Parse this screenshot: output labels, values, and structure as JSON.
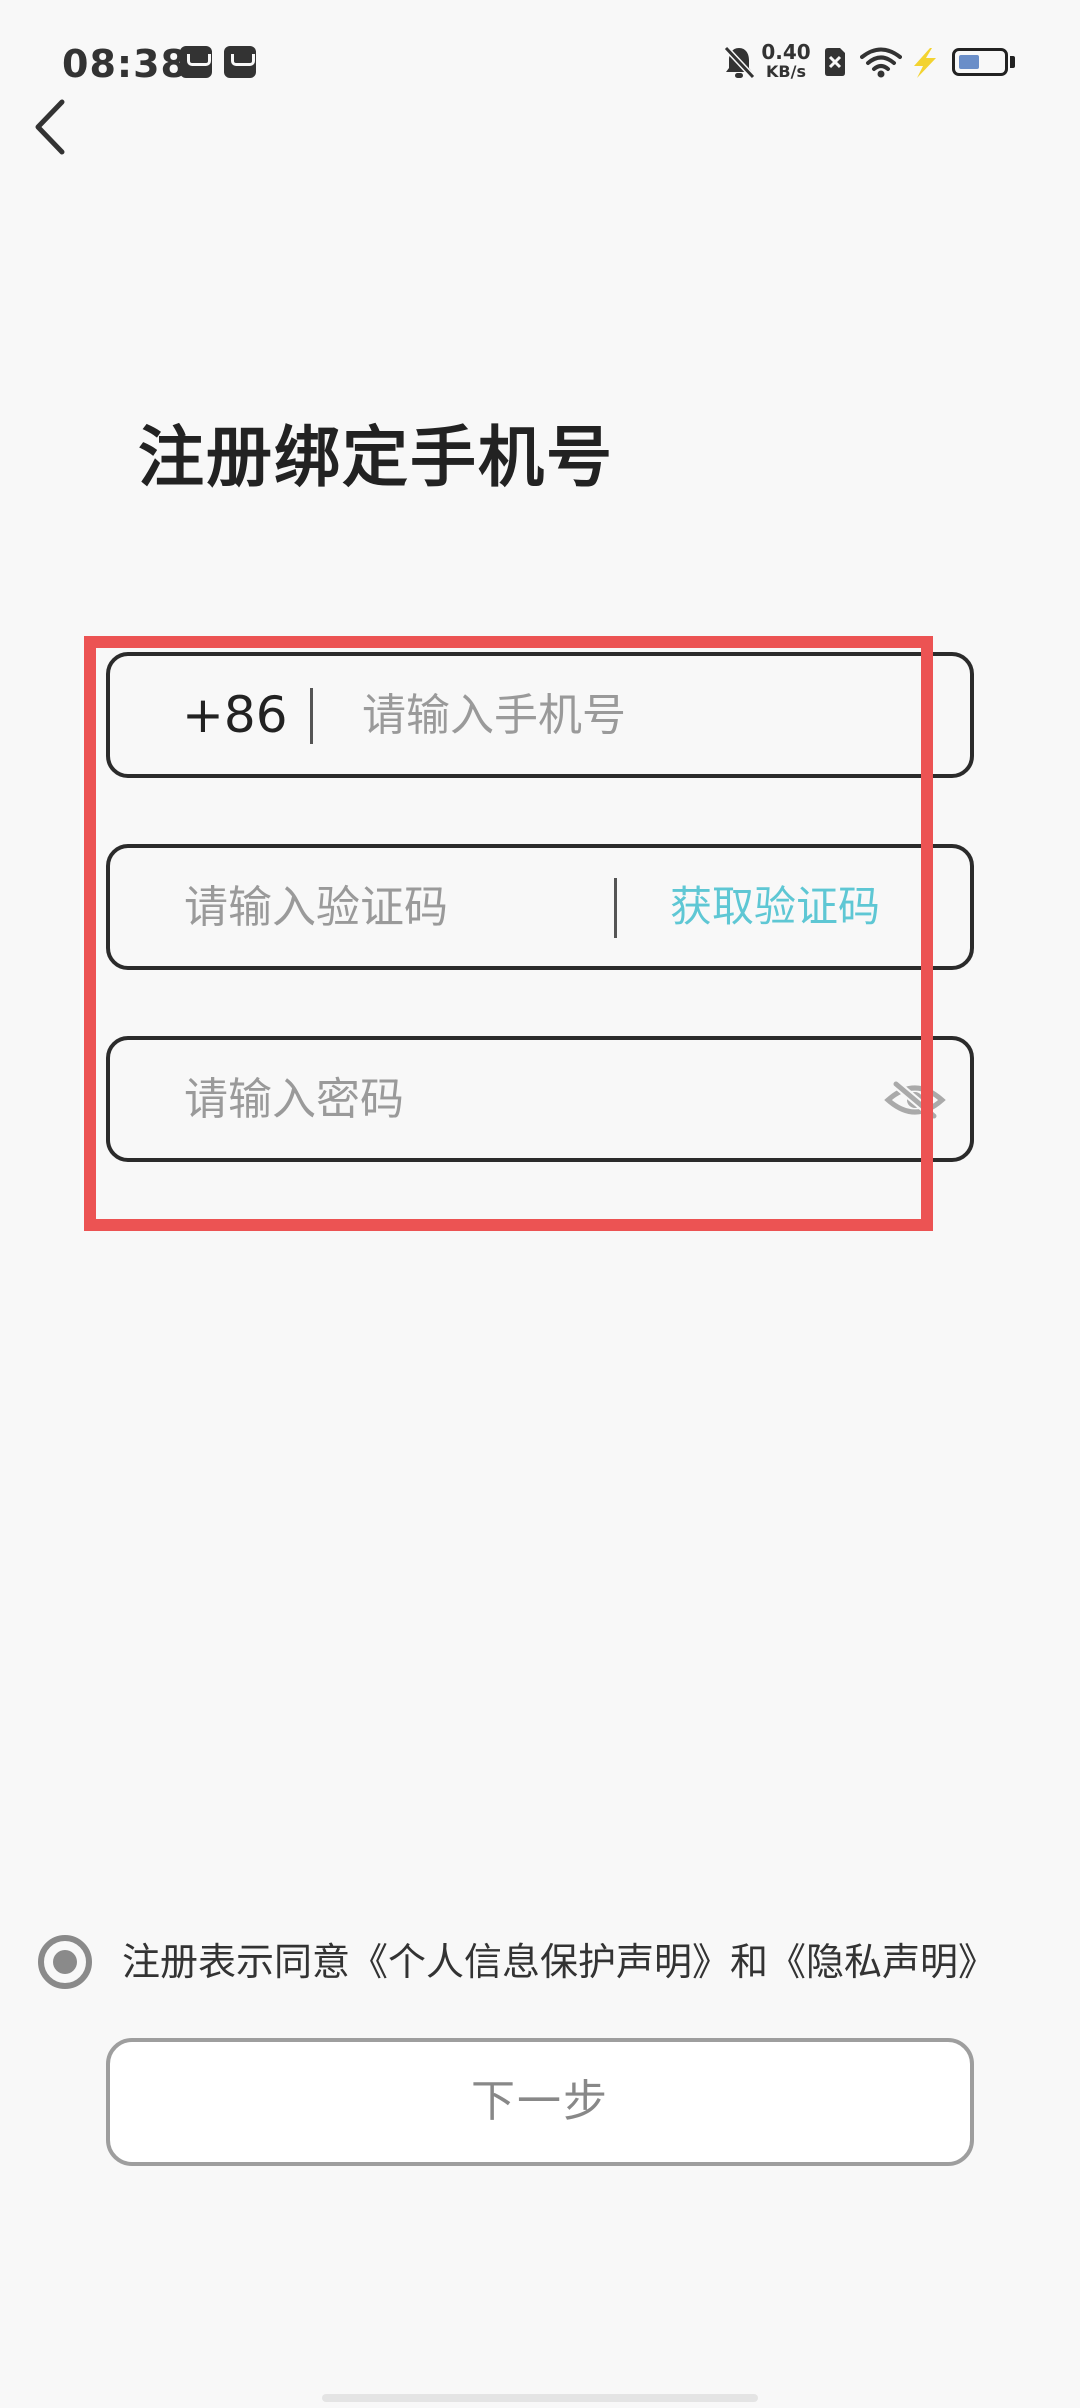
{
  "status_bar": {
    "time": "08:38",
    "network_speed_value": "0.40",
    "network_speed_unit": "KB/s",
    "icons": [
      "app-store-icon",
      "shopping-bag-icon",
      "bell-muted-icon",
      "sim-blocked-icon",
      "wifi-icon",
      "charging-bolt-icon",
      "battery-icon"
    ],
    "accent_bolt_color": "#f3d330"
  },
  "nav": {
    "back_icon": "chevron-left-icon"
  },
  "page": {
    "title": "注册绑定手机号"
  },
  "form": {
    "phone": {
      "country_code": "+86",
      "placeholder": "请输入手机号",
      "value": ""
    },
    "code": {
      "placeholder": "请输入验证码",
      "value": "",
      "get_code_label": "获取验证码"
    },
    "password": {
      "placeholder": "请输入密码",
      "value": "",
      "toggle_icon": "eye-slash-icon"
    }
  },
  "agreement": {
    "prefix": "注册表示同意",
    "privacy_protection_link": "《个人信息保护声明》",
    "conjunction": "和",
    "privacy_link": "《隐私声明》",
    "checked": true
  },
  "actions": {
    "next_label": "下一步"
  },
  "colors": {
    "background": "#f8f8f8",
    "annotation_box": "#ec5353",
    "link_accent": "#5ec7d4",
    "field_border": "#2b2b2b",
    "disabled_button_text": "#888888"
  }
}
